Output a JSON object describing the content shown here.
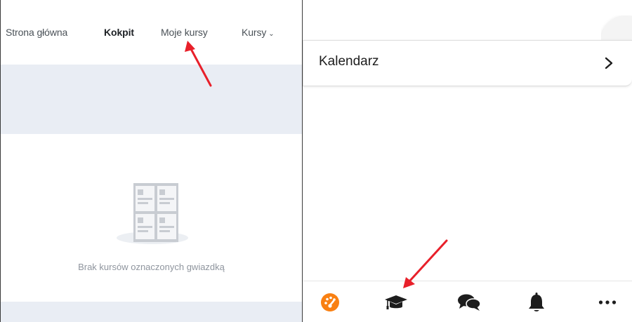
{
  "left_panel": {
    "nav": {
      "home": "Strona główna",
      "dashboard": "Kokpit",
      "my_courses": "Moje kursy",
      "courses": "Kursy"
    },
    "empty_state": {
      "message": "Brak kursów oznaczonych gwiazdką"
    }
  },
  "right_panel": {
    "calendar": {
      "title": "Kalendarz"
    },
    "tabbar": {
      "items": [
        {
          "icon": "dashboard-icon",
          "active": true,
          "color": "#f98012"
        },
        {
          "icon": "graduation-cap-icon",
          "active": false
        },
        {
          "icon": "chat-bubbles-icon",
          "active": false
        },
        {
          "icon": "bell-icon",
          "active": false
        },
        {
          "icon": "more-icon",
          "active": false
        }
      ]
    }
  },
  "colors": {
    "accent_orange": "#f98012",
    "annotation_arrow": "#e8202a",
    "band_grey": "#e9edf4",
    "text_dark": "#1d2125"
  }
}
